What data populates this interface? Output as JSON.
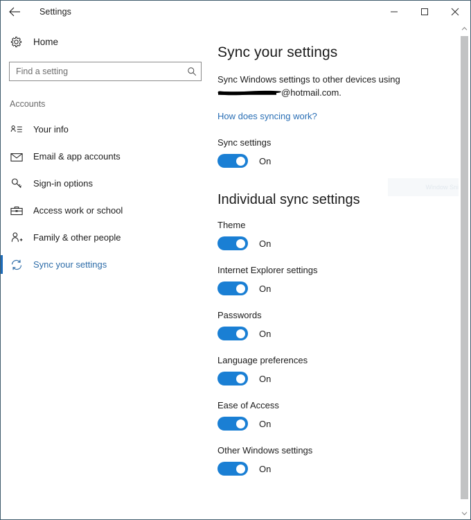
{
  "window": {
    "title": "Settings",
    "back_icon": "back-arrow-icon",
    "controls": {
      "minimize": "minimize-icon",
      "maximize": "maximize-icon",
      "close": "close-icon"
    }
  },
  "sidebar": {
    "home": {
      "label": "Home",
      "icon": "gear-icon"
    },
    "search": {
      "placeholder": "Find a setting",
      "value": "",
      "icon": "search-icon"
    },
    "section_label": "Accounts",
    "items": [
      {
        "label": "Your info",
        "icon": "user-info-icon",
        "selected": false
      },
      {
        "label": "Email & app accounts",
        "icon": "envelope-icon",
        "selected": false
      },
      {
        "label": "Sign-in options",
        "icon": "key-icon",
        "selected": false
      },
      {
        "label": "Access work or school",
        "icon": "briefcase-icon",
        "selected": false
      },
      {
        "label": "Family & other people",
        "icon": "user-plus-icon",
        "selected": false
      },
      {
        "label": "Sync your settings",
        "icon": "sync-icon",
        "selected": true
      }
    ]
  },
  "main": {
    "page_title": "Sync your settings",
    "description_line1": "Sync Windows settings to other devices using",
    "description_redacted_suffix": "@hotmail.com.",
    "help_link": "How does syncing work?",
    "sync_settings": {
      "label": "Sync settings",
      "state": "On",
      "enabled": true
    },
    "individual_heading": "Individual sync settings",
    "individual_items": [
      {
        "label": "Theme",
        "state": "On",
        "enabled": true
      },
      {
        "label": "Internet Explorer settings",
        "state": "On",
        "enabled": true
      },
      {
        "label": "Passwords",
        "state": "On",
        "enabled": true
      },
      {
        "label": "Language preferences",
        "state": "On",
        "enabled": true
      },
      {
        "label": "Ease of Access",
        "state": "On",
        "enabled": true
      },
      {
        "label": "Other Windows settings",
        "state": "On",
        "enabled": true
      }
    ],
    "ghost_artifact_text": "Window Sni"
  },
  "scrollbar": {
    "up_icon": "chevron-up-icon",
    "down_icon": "chevron-down-icon"
  },
  "colors": {
    "accent": "#1e6bb8",
    "toggle_on": "#1a7fd4",
    "link": "#2a6fb5",
    "selected_text": "#2d6ca8",
    "window_border": "#3f5b6c"
  }
}
